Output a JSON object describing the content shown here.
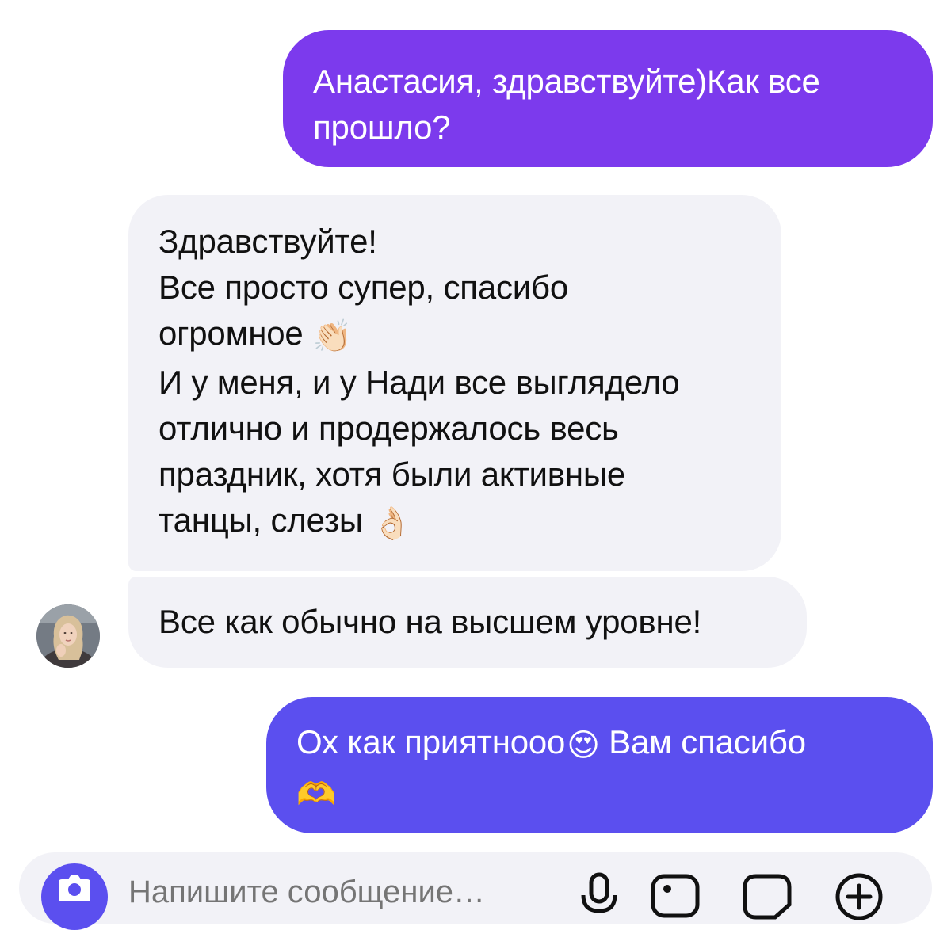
{
  "theme": {
    "outgoing_top": "#7c3aed",
    "outgoing_bottom": "#5b4fef",
    "incoming": "#f2f2f7",
    "composer": "#f2f2f7",
    "accent": "#5b4fef",
    "icon": "#111111"
  },
  "messages": [
    {
      "direction": "outgoing",
      "lines": [
        "Анастасия, здравствуйте)Как все",
        "прошло?"
      ]
    },
    {
      "direction": "incoming",
      "lines": [
        "Здравствуйте!",
        "Все просто супер, спасибо",
        "огромное",
        "И у меня, и у Нади все выглядело",
        "отлично и продержалось весь",
        "праздник, хотя были активные",
        "танцы, слезы"
      ],
      "emojis": [
        "👏🏻",
        "👌🏻"
      ]
    },
    {
      "direction": "incoming",
      "lines": [
        "Все как обычно на высшем уровне!"
      ],
      "sender_avatar": "avatar"
    },
    {
      "direction": "outgoing",
      "lines": [
        "Ох как приятнооо",
        "Вам спасибо"
      ],
      "emojis": [
        "😍",
        "🫶"
      ]
    }
  ],
  "composer": {
    "placeholder": "Напишите сообщение…",
    "icons": [
      "camera-icon",
      "microphone-icon",
      "gallery-icon",
      "sticker-icon",
      "add-icon"
    ]
  }
}
